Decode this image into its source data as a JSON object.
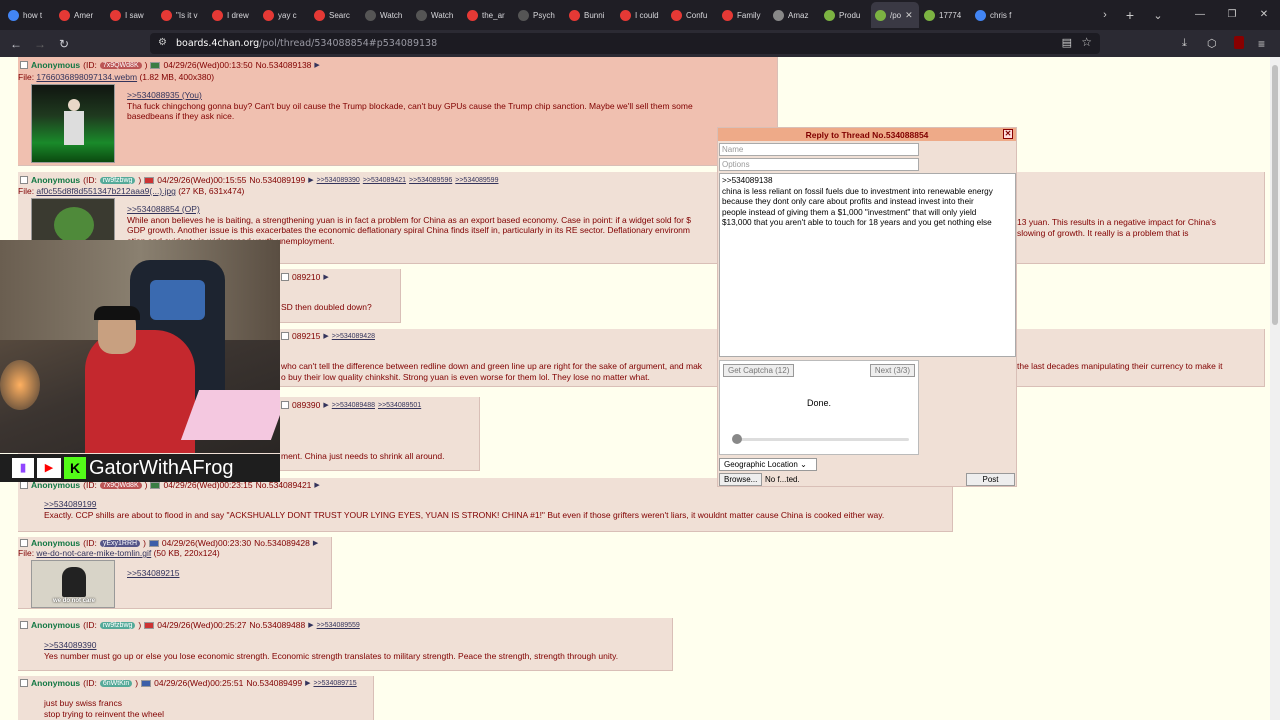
{
  "browser": {
    "tabs": [
      {
        "label": "how t",
        "color": "#4285f4",
        "icon": "google-icon"
      },
      {
        "label": "Amer",
        "color": "#e53935",
        "icon": "reddit-icon"
      },
      {
        "label": "I saw",
        "color": "#e53935",
        "icon": "reddit-icon"
      },
      {
        "label": "\"Is it v",
        "color": "#e53935",
        "icon": "reddit-icon"
      },
      {
        "label": "I drew",
        "color": "#e53935",
        "icon": "reddit-icon"
      },
      {
        "label": "yay c",
        "color": "#e53935",
        "icon": "reddit-icon"
      },
      {
        "label": "Searc",
        "color": "#e53935",
        "icon": "reddit-icon"
      },
      {
        "label": "Watch",
        "color": "#555",
        "icon": "m-icon"
      },
      {
        "label": "Watch",
        "color": "#555",
        "icon": "m-icon"
      },
      {
        "label": "the_ar",
        "color": "#e53935",
        "icon": "youtube-icon"
      },
      {
        "label": "Psych",
        "color": "#555",
        "icon": "play-icon"
      },
      {
        "label": "Bunni",
        "color": "#e53935",
        "icon": "youtube-icon"
      },
      {
        "label": "I could",
        "color": "#e53935",
        "icon": "youtube-icon"
      },
      {
        "label": "Confu",
        "color": "#e53935",
        "icon": "youtube-icon"
      },
      {
        "label": "Family",
        "color": "#e53935",
        "icon": "youtube-icon"
      },
      {
        "label": "Amaz",
        "color": "#888",
        "icon": "amazon-icon"
      },
      {
        "label": "Produ",
        "color": "#7cb342",
        "icon": "link-icon"
      },
      {
        "label": "/po",
        "color": "#7cb342",
        "icon": "4chan-icon",
        "active": true
      },
      {
        "label": "17774",
        "color": "#7cb342",
        "icon": "4chan-icon"
      },
      {
        "label": "chris f",
        "color": "#4285f4",
        "icon": "google-icon"
      }
    ],
    "url_host": "boards.4chan.org",
    "url_path": "/pol/thread/534088854#p534089138"
  },
  "posts": [
    {
      "name": "Anonymous",
      "id_label": "(ID: ",
      "id": "7x9QWd8K",
      "id_color": "#b55",
      "flag": "#3a7d44",
      "date": "04/29/26(Wed)00:13:50",
      "no": "No.534089138",
      "backlinks": [],
      "file_prefix": "File: ",
      "file_link": "1766036898097134.webm",
      "file_meta": " (1.82 MB, 400x380)",
      "quote": ">>534088935 (You)",
      "text": [
        "Tha fuck chingchong gonna buy? Can't buy oil cause the Trump blockade, can't buy GPUs cause the Trump chip sanction. Maybe we'll sell them some",
        "basedbeans if they ask nice."
      ]
    },
    {
      "name": "Anonymous",
      "id_label": "(ID: ",
      "id": "rw9fzbwg",
      "id_color": "#5a9",
      "flag": "#c33",
      "date": "04/29/26(Wed)00:15:55",
      "no": "No.534089199",
      "backlinks": [
        ">>534089390",
        ">>534089421",
        ">>534089596",
        ">>534089599"
      ],
      "file_prefix": "File: ",
      "file_link": "af0c55d8f8d551347b212aaa9(...).jpg",
      "file_meta": " (27 KB, 631x474)",
      "quote": ">>534088854 (OP)",
      "text": [
        "While anon believes he is baiting, a strengthening yuan is in fact a problem for China as an export based economy. Case in point: if a widget sold for $",
        "GDP growth. Another issue is this exacerbates the economic deflationary spiral China finds itself in, particularly in its RE sector. Deflationary environm",
        "ation and evident via widespread youth unemployment."
      ],
      "text_right": [
        "13 yuan. This results in a negative impact for China's",
        "slowing of growth. It really is a problem that is"
      ]
    },
    {
      "no": "089210",
      "text": [
        "SD then doubled down?"
      ]
    },
    {
      "no": "089215",
      "backlinks": [
        ">>534089428"
      ],
      "text": [
        "who can't tell the difference between redline down and green line up are right for the sake of argument, and mak",
        "o buy their low quality chinkshit. Strong yuan is even worse for them lol. They lose no matter what."
      ],
      "text_right": [
        "the last decades manipulating their currency to make it"
      ]
    },
    {
      "no": "089390",
      "backlinks": [
        ">>534089488",
        ">>534089501"
      ],
      "text": [
        "ment. China just needs to shrink all around."
      ]
    },
    {
      "name": "Anonymous",
      "id_label": "(ID: ",
      "id": "7x9QWd8K",
      "id_color": "#b55",
      "flag": "#3a7d44",
      "date": "04/29/26(Wed)00:23:15",
      "no": "No.534089421",
      "backlinks": [],
      "quote": ">>534089199",
      "text": [
        "Exactly. CCP shills are about to flood in and say \"ACKSHUALLY DONT TRUST YOUR LYING EYES, YUAN IS STRONK! CHINA #1!\" But even if those grifters weren't liars, it wouldnt matter cause China is cooked either way."
      ]
    },
    {
      "name": "Anonymous",
      "id_label": "(ID: ",
      "id": "yExy1RRH",
      "id_color": "#558",
      "flag": "#3c5fa8",
      "date": "04/29/26(Wed)00:23:30",
      "no": "No.534089428",
      "backlinks": [],
      "file_prefix": "File: ",
      "file_link": "we-do-not-care-mike-tomlin.gif",
      "file_meta": " (50 KB, 220x124)",
      "quote": ">>534089215",
      "text": [],
      "thumb_caption": "we do not care"
    },
    {
      "name": "Anonymous",
      "id_label": "(ID: ",
      "id": "rw9fzbwg",
      "id_color": "#5a9",
      "flag": "#c33",
      "date": "04/29/26(Wed)00:25:27",
      "no": "No.534089488",
      "backlinks": [
        ">>534089559"
      ],
      "quote": ">>534089390",
      "text": [
        "Yes number must go up or else you lose economic strength. Economic strength translates to military strength. Peace the strength, strength through unity."
      ]
    },
    {
      "name": "Anonymous",
      "id_label": "(ID: ",
      "id": "6nWtKin",
      "id_color": "#5a9",
      "flag": "#3c5fa8",
      "date": "04/29/26(Wed)00:25:51",
      "no": "No.534089499",
      "backlinks": [
        ">>534089715"
      ],
      "text": [
        "just buy swiss francs",
        "stop trying to reinvent the wheel"
      ]
    }
  ],
  "reply": {
    "title": "Reply to Thread No.534088854",
    "close": "✕",
    "name_ph": "Name",
    "options_ph": "Options",
    "comment": [
      ">>534089138",
      "china is less reliant on fossil fuels due to investment into renewable energy",
      "because they dont only care about profits and instead invest into their",
      "people instead of giving them a $1,000 \"investment\" that will only yield",
      "$13,000 that you aren't able to touch for 18 years and you get nothing else"
    ],
    "get_captcha": "Get Captcha (12)",
    "next": "Next (3/3)",
    "done": "Done.",
    "geo": "Geographic Location",
    "browse": "Browse...",
    "no_file": "No f...ted.",
    "post": "Post"
  },
  "stream": {
    "name": "GatorWithAFrog"
  }
}
